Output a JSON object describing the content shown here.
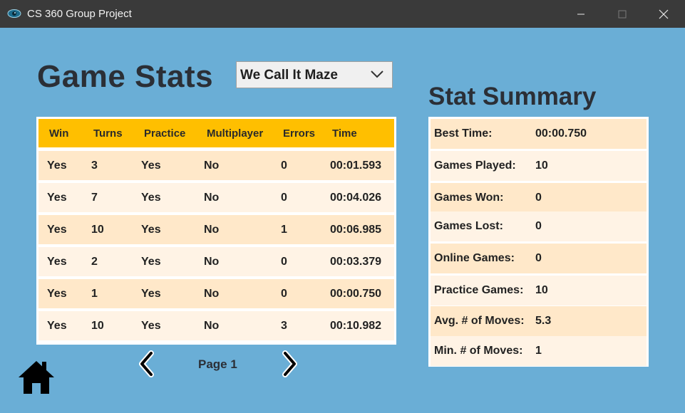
{
  "window": {
    "title": "CS 360 Group Project",
    "icon": "app-eye-icon"
  },
  "page": {
    "title": "Game Stats"
  },
  "game_select": {
    "value": "We Call It Maze"
  },
  "table": {
    "headers": [
      "Win",
      "Turns",
      "Practice",
      "Multiplayer",
      "Errors",
      "Time"
    ],
    "rows": [
      [
        "Yes",
        "3",
        "Yes",
        "No",
        "0",
        "00:01.593"
      ],
      [
        "Yes",
        "7",
        "Yes",
        "No",
        "0",
        "00:04.026"
      ],
      [
        "Yes",
        "10",
        "Yes",
        "No",
        "1",
        "00:06.985"
      ],
      [
        "Yes",
        "2",
        "Yes",
        "No",
        "0",
        "00:03.379"
      ],
      [
        "Yes",
        "1",
        "Yes",
        "No",
        "0",
        "00:00.750"
      ],
      [
        "Yes",
        "10",
        "Yes",
        "No",
        "3",
        "00:10.982"
      ]
    ]
  },
  "pager": {
    "label": "Page 1"
  },
  "summary": {
    "title": "Stat Summary",
    "items": [
      {
        "label": "Best Time:",
        "value": "00:00.750"
      },
      {
        "label": "Games Played:",
        "value": "10"
      },
      {
        "label": "Games Won:",
        "value": "0"
      },
      {
        "label": "Games Lost:",
        "value": "0"
      },
      {
        "label": "Online Games:",
        "value": "0"
      },
      {
        "label": "Practice Games:",
        "value": "10"
      },
      {
        "label": "Avg. # of Moves:",
        "value": "5.3"
      },
      {
        "label": "Min. # of Moves:",
        "value": "1"
      }
    ]
  },
  "colors": {
    "background": "#6aaed6",
    "titlebar": "#3a3a3a",
    "table_header": "#ffbf00",
    "row_odd": "#ffe8c9",
    "row_even": "#fff3e5",
    "heading_text": "#2b2f36"
  }
}
